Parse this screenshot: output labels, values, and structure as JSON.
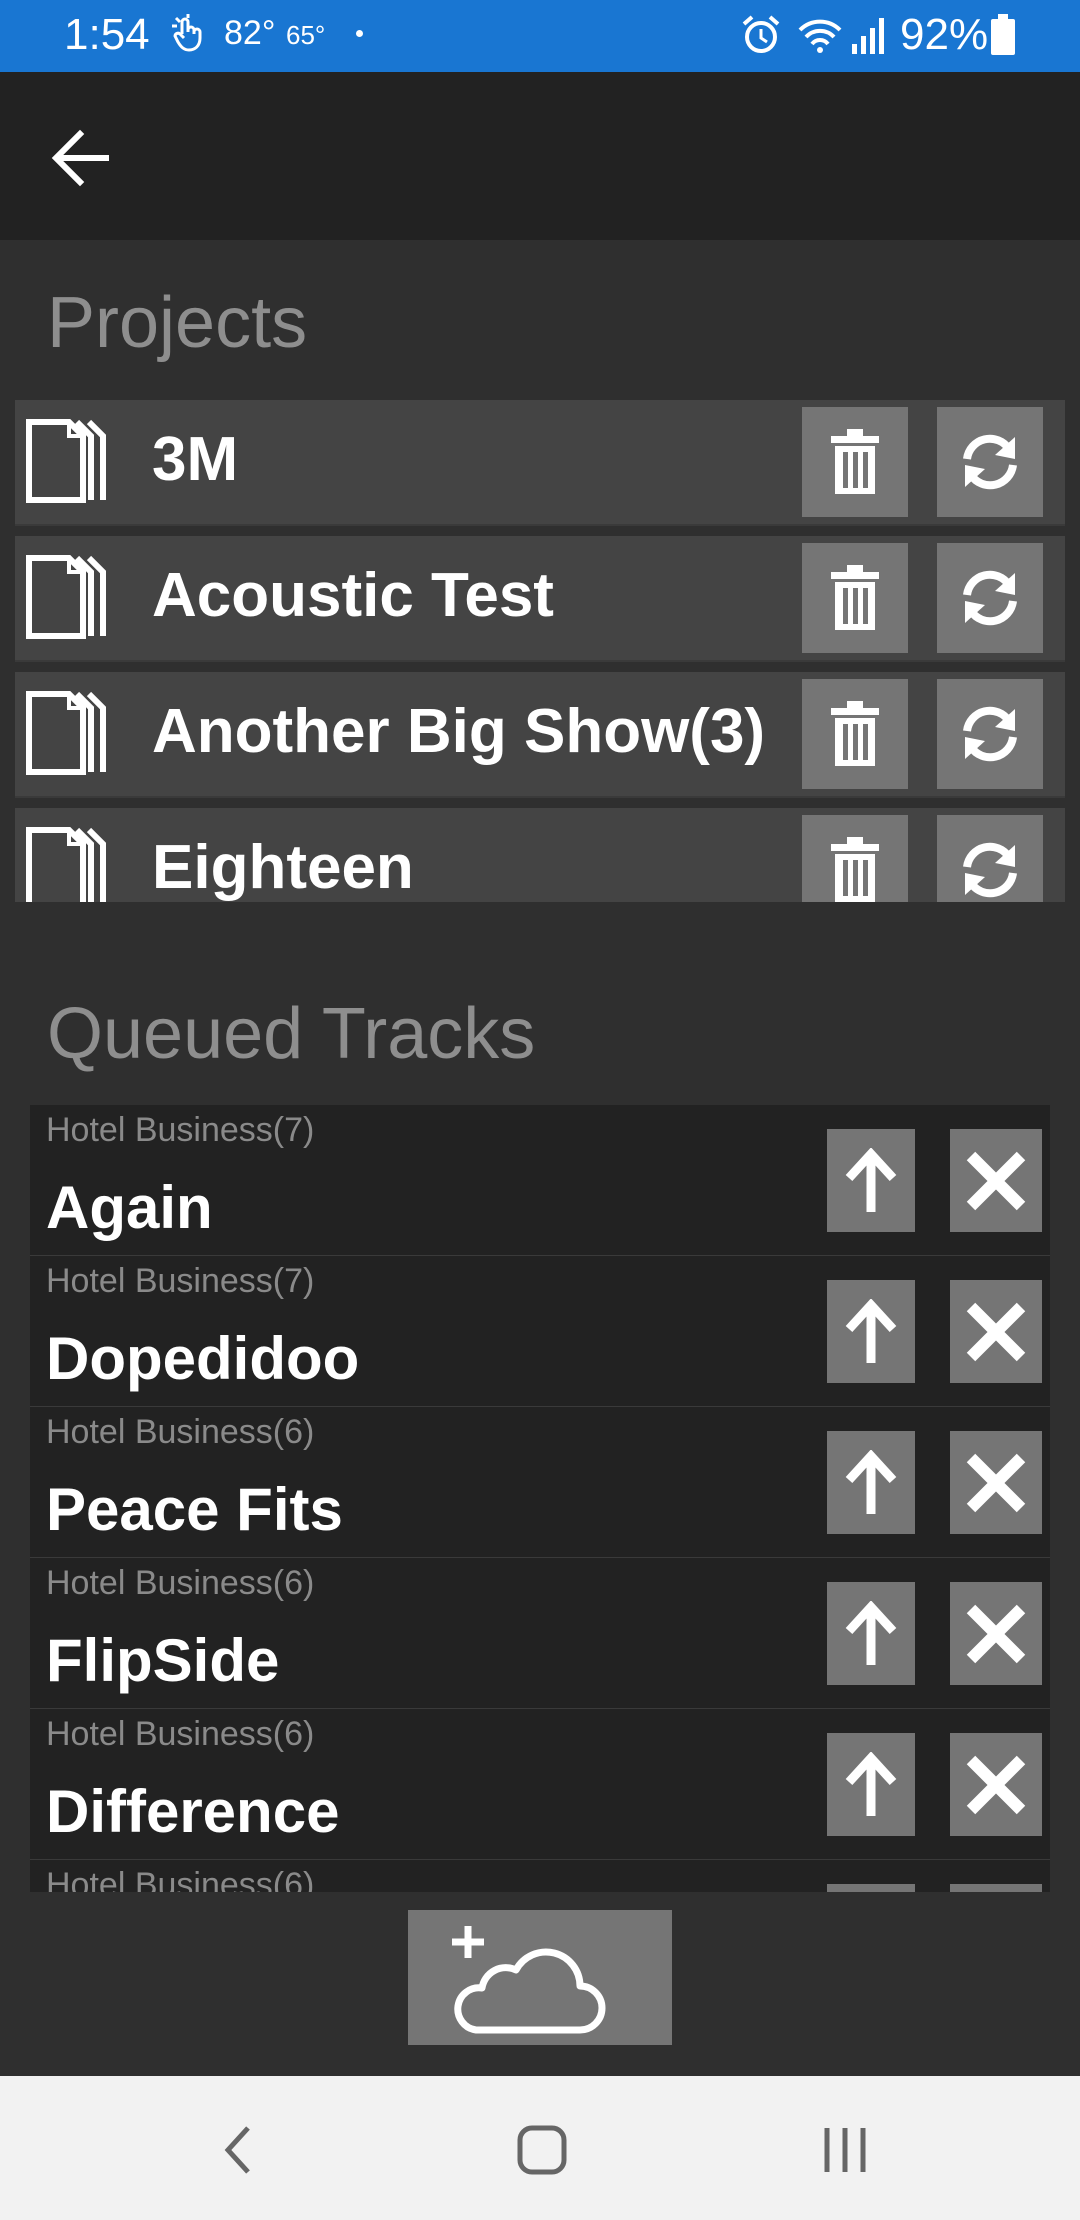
{
  "status_bar": {
    "time": "1:54",
    "temp_high": "82°",
    "temp_low": "65°",
    "battery": "92%",
    "icons": [
      "touch-icon",
      "alarm-icon",
      "wifi-icon",
      "signal-icon",
      "battery-icon"
    ]
  },
  "toolbar": {
    "back_icon": "arrow-left-icon"
  },
  "projects": {
    "title": "Projects",
    "items": [
      {
        "name": "3M"
      },
      {
        "name": "Acoustic Test"
      },
      {
        "name": "Another Big Show(3)"
      },
      {
        "name": "Eighteen"
      }
    ]
  },
  "queued": {
    "title": "Queued Tracks",
    "items": [
      {
        "project": "Hotel Business(7)",
        "track": "Again"
      },
      {
        "project": "Hotel Business(7)",
        "track": "Dopedidoo"
      },
      {
        "project": "Hotel Business(6)",
        "track": "Peace Fits"
      },
      {
        "project": "Hotel Business(6)",
        "track": "FlipSide"
      },
      {
        "project": "Hotel Business(6)",
        "track": "Difference"
      },
      {
        "project": "Hotel Business(6)",
        "track": ""
      }
    ]
  },
  "colors": {
    "status_bar": "#1976d2",
    "toolbar": "#222222",
    "background": "#2f2f2f",
    "row": "#444444",
    "button": "#757575",
    "section_title": "#8e8e8e"
  }
}
